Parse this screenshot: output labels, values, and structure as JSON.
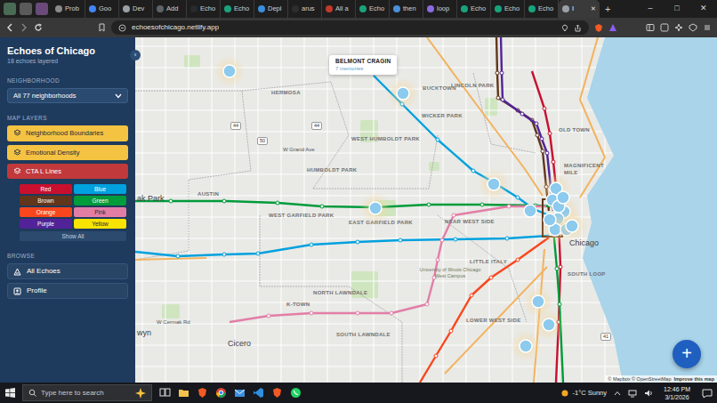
{
  "browser": {
    "tabs": [
      {
        "label": "Prob",
        "selected": false
      },
      {
        "label": "Goo",
        "selected": false
      },
      {
        "label": "Dev",
        "selected": false
      },
      {
        "label": "Add",
        "selected": false
      },
      {
        "label": "Echo",
        "selected": false
      },
      {
        "label": "Echo",
        "selected": false
      },
      {
        "label": "Depl",
        "selected": false
      },
      {
        "label": "arus",
        "selected": false
      },
      {
        "label": "All a",
        "selected": false
      },
      {
        "label": "Echo",
        "selected": false
      },
      {
        "label": "then",
        "selected": false
      },
      {
        "label": "loop",
        "selected": false
      },
      {
        "label": "Echo",
        "selected": false
      },
      {
        "label": "Echo",
        "selected": false
      },
      {
        "label": "Echo",
        "selected": false
      },
      {
        "label": "I",
        "selected": true
      }
    ],
    "tab_close": "✕",
    "new_tab": "+",
    "window_controls": [
      "–",
      "□",
      "✕"
    ],
    "address": "echoesofchicago.netlify.app"
  },
  "sidebar": {
    "title": "Echoes of Chicago",
    "subtitle": "18 echoes layered",
    "collapse": "‹",
    "neighborhood_label": "NEIGHBORHOOD",
    "neighborhood_select": "All 77 neighborhoods",
    "layers_label": "MAP LAYERS",
    "layers": [
      {
        "label": "Neighborhood Boundaries",
        "on": true,
        "color": "#f5c342"
      },
      {
        "label": "Emotional Density",
        "on": true,
        "color": "#f5c342"
      },
      {
        "label": "CTA L Lines",
        "on": true,
        "color": "#c2393c"
      }
    ],
    "lines": [
      {
        "label": "Red",
        "color": "#c8102e"
      },
      {
        "label": "Blue",
        "color": "#00a1de"
      },
      {
        "label": "Brown",
        "color": "#62361b"
      },
      {
        "label": "Green",
        "color": "#009b3a"
      },
      {
        "label": "Orange",
        "color": "#f9461c"
      },
      {
        "label": "Pink",
        "color": "#e27ea6"
      },
      {
        "label": "Purple",
        "color": "#522398"
      },
      {
        "label": "Yellow",
        "color": "#f9e300"
      }
    ],
    "show_all": "Show All",
    "browse_label": "BROWSE",
    "browse": [
      {
        "label": "All Echoes"
      },
      {
        "label": "Profile"
      }
    ]
  },
  "map": {
    "labels": [
      {
        "text": "HERMOSA",
        "kind": "area"
      },
      {
        "text": "W Grand Ave",
        "kind": "street"
      },
      {
        "text": "WEST HUMBOLDT PARK",
        "kind": "area"
      },
      {
        "text": "HUMBOLDT PARK",
        "kind": "area"
      },
      {
        "text": "AUSTIN",
        "kind": "area"
      },
      {
        "text": "ak Park",
        "kind": "city"
      },
      {
        "text": "WEST GARFIELD PARK",
        "kind": "area"
      },
      {
        "text": "EAST GARFIELD PARK",
        "kind": "area"
      },
      {
        "text": "NEAR WEST SIDE",
        "kind": "area"
      },
      {
        "text": "LITTLE ITALY",
        "kind": "area"
      },
      {
        "text": "University of Illinois Chicago West Campus",
        "kind": "place"
      },
      {
        "text": "NORTH LAWNDALE",
        "kind": "area"
      },
      {
        "text": "K-TOWN",
        "kind": "area"
      },
      {
        "text": "SOUTH LAWNDALE",
        "kind": "area"
      },
      {
        "text": "LOWER WEST SIDE",
        "kind": "area"
      },
      {
        "text": "Cicero",
        "kind": "city"
      },
      {
        "text": "W Cermak Rd",
        "kind": "street"
      },
      {
        "text": "wyn",
        "kind": "city"
      },
      {
        "text": "LINCOLN PARK",
        "kind": "area"
      },
      {
        "text": "OLD TOWN",
        "kind": "area"
      },
      {
        "text": "MAGNIFICENT MILE",
        "kind": "area"
      },
      {
        "text": "Chicago",
        "kind": "city"
      },
      {
        "text": "SOUTH LOOP",
        "kind": "area"
      },
      {
        "text": "BUCKTOWN",
        "kind": "area"
      },
      {
        "text": "WICKER PARK",
        "kind": "area"
      }
    ],
    "shields": [
      "44",
      "50",
      "44",
      "41"
    ],
    "pins": [
      {
        "halo": true
      },
      {
        "halo": true
      },
      {
        "halo": true
      },
      {
        "halo": true
      },
      {
        "halo": false
      },
      {
        "halo": true
      },
      {
        "halo": false
      },
      {
        "halo": true
      },
      {
        "halo": false
      },
      {
        "halo": true
      },
      {
        "halo": false
      },
      {
        "halo": true
      },
      {
        "halo": true
      },
      {
        "halo": true
      },
      {
        "halo": true
      },
      {
        "halo": false
      },
      {
        "halo": false
      },
      {
        "halo": false
      }
    ],
    "tooltip": {
      "title": "BELMONT CRAGIN",
      "subtitle": "7 memories"
    },
    "add_button": "+",
    "attribution": "© Mapbox © OpenStreetMap",
    "improve": "Improve this map"
  },
  "taskbar": {
    "search": "Type here to search",
    "weather": "-1°C Sunny",
    "time": "12:46 PM",
    "date": "3/1/2026"
  }
}
